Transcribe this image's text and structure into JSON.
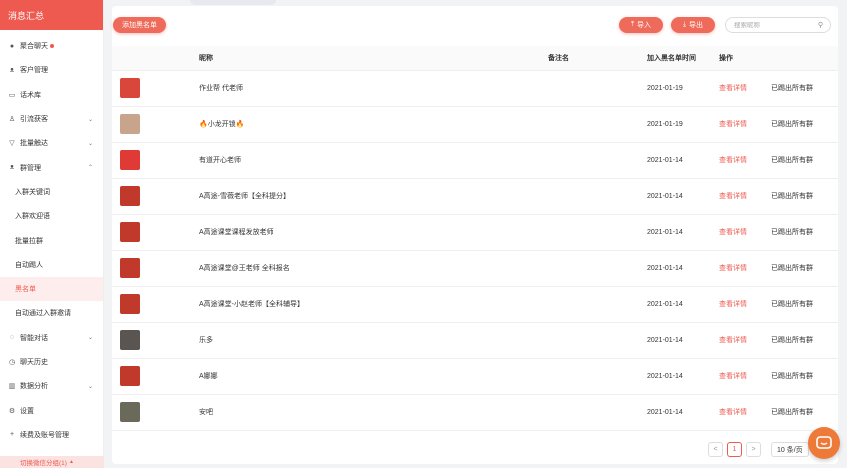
{
  "brand": {
    "title": "消息汇总"
  },
  "sidebar": {
    "items": [
      {
        "label": "聚合聊天",
        "icon": "chat-icon",
        "badge": true
      },
      {
        "label": "客户管理",
        "icon": "customers-icon"
      },
      {
        "label": "话术库",
        "icon": "folder-icon"
      },
      {
        "label": "引流获客",
        "icon": "user-icon",
        "chevron": "⌄"
      },
      {
        "label": "批量触达",
        "icon": "filter-icon",
        "chevron": "⌄"
      },
      {
        "label": "群管理",
        "icon": "group-icon",
        "chevron": "⌃"
      },
      {
        "label": "入群关键词",
        "sub": true
      },
      {
        "label": "入群欢迎语",
        "sub": true
      },
      {
        "label": "批量拉群",
        "sub": true
      },
      {
        "label": "自动踢人",
        "sub": true
      },
      {
        "label": "黑名单",
        "sub": true,
        "active": true
      },
      {
        "label": "自动通过入群邀请",
        "sub": true
      },
      {
        "label": "智能对话",
        "icon": "bulb-icon",
        "chevron": "⌄"
      },
      {
        "label": "聊天历史",
        "icon": "clock-icon"
      },
      {
        "label": "数据分析",
        "icon": "chart-icon",
        "chevron": "⌄"
      },
      {
        "label": "设置",
        "icon": "gear-icon"
      },
      {
        "label": "续费及账号管理",
        "icon": "plus-icon"
      }
    ],
    "switch_group": "切换微信分组(1)"
  },
  "toolbar": {
    "add_label": "添加黑名单",
    "import_label": "导入",
    "export_label": "导出",
    "search_placeholder": "搜索昵称"
  },
  "table": {
    "headers": {
      "nickname": "昵称",
      "remark": "备注名",
      "time": "加入黑名单时间",
      "op": "操作"
    },
    "rows": [
      {
        "name": "作业帮 代老师",
        "remark": "",
        "time": "2021-01-19",
        "op": "查看详情",
        "status": "已踢出所有群",
        "avatar_color": "#d9473b"
      },
      {
        "name": "🔥小龙开锁🔥",
        "remark": "",
        "time": "2021-01-19",
        "op": "查看详情",
        "status": "已踢出所有群",
        "avatar_color": "#c9a48c"
      },
      {
        "name": "有道开心老师",
        "remark": "",
        "time": "2021-01-14",
        "op": "查看详情",
        "status": "已踢出所有群",
        "avatar_color": "#e03a36"
      },
      {
        "name": "A高途-雪薇老师【全科提分】",
        "remark": "",
        "time": "2021-01-14",
        "op": "查看详情",
        "status": "已踢出所有群",
        "avatar_color": "#c0392b"
      },
      {
        "name": "A高途课堂课程发放老师",
        "remark": "",
        "time": "2021-01-14",
        "op": "查看详情",
        "status": "已踢出所有群",
        "avatar_color": "#c0392b"
      },
      {
        "name": "A高途课堂@王老师 全科报名",
        "remark": "",
        "time": "2021-01-14",
        "op": "查看详情",
        "status": "已踢出所有群",
        "avatar_color": "#c0392b"
      },
      {
        "name": "A高途课堂-小赵老师【全科辅导】",
        "remark": "",
        "time": "2021-01-14",
        "op": "查看详情",
        "status": "已踢出所有群",
        "avatar_color": "#c0392b"
      },
      {
        "name": "乐多",
        "remark": "",
        "time": "2021-01-14",
        "op": "查看详情",
        "status": "已踢出所有群",
        "avatar_color": "#5a5550"
      },
      {
        "name": "A娜娜",
        "remark": "",
        "time": "2021-01-14",
        "op": "查看详情",
        "status": "已踢出所有群",
        "avatar_color": "#c0392b"
      },
      {
        "name": "安吧",
        "remark": "",
        "time": "2021-01-14",
        "op": "查看详情",
        "status": "已踢出所有群",
        "avatar_color": "#6b6a5a"
      }
    ]
  },
  "pagination": {
    "current": "1",
    "prev": "<",
    "next": ">",
    "page_size": "10 条/页"
  },
  "colors": {
    "accent": "#ee5a50"
  }
}
